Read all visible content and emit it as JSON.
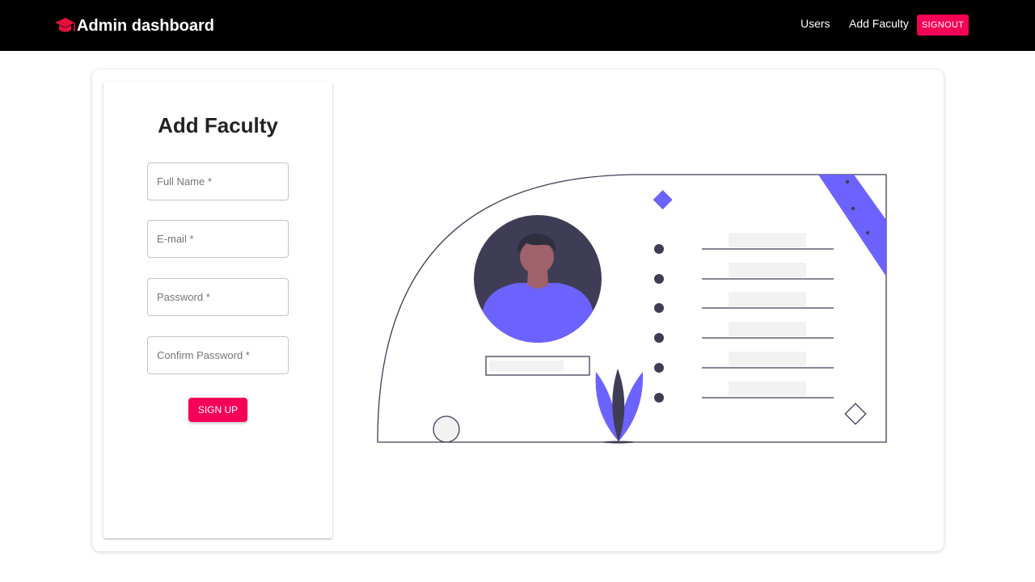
{
  "navbar": {
    "brand": "Admin dashboard",
    "brand_icon": "graduation-cap-icon",
    "links": [
      "Users",
      "Add Faculty"
    ],
    "signout_label": "SIGNOUT"
  },
  "form": {
    "title": "Add Faculty",
    "fields": [
      {
        "placeholder": "Full Name *"
      },
      {
        "placeholder": "E-mail *"
      },
      {
        "placeholder": "Password *"
      },
      {
        "placeholder": "Confirm Password *"
      }
    ],
    "submit_label": "SIGN UP"
  },
  "colors": {
    "navbar_bg": "#000000",
    "accent": "#f50057",
    "illustration_primary": "#6c63ff",
    "illustration_dark": "#3f3d56"
  }
}
